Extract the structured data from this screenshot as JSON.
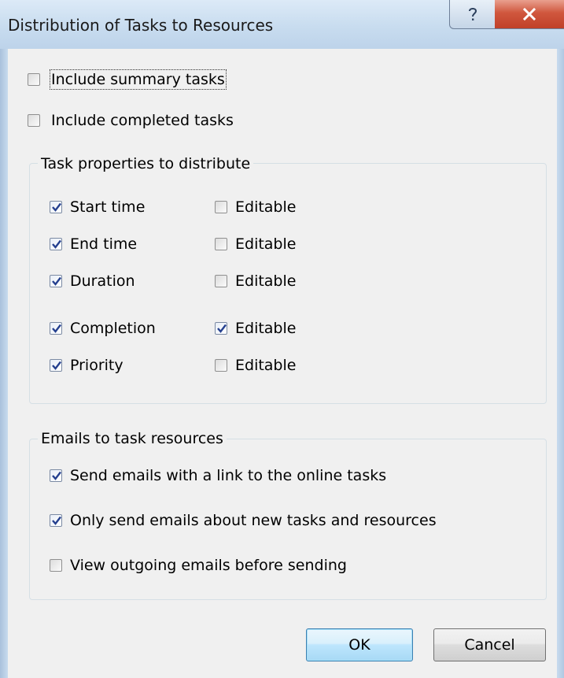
{
  "window": {
    "title": "Distribution of Tasks to Resources",
    "help_glyph": "?",
    "close_glyph": "X"
  },
  "options": {
    "include_summary": {
      "label": "Include summary tasks",
      "checked": false
    },
    "include_completed": {
      "label": "Include completed tasks",
      "checked": false
    }
  },
  "task_properties": {
    "title": "Task properties to distribute",
    "rows": [
      {
        "label": "Start time",
        "checked": true,
        "editable_label": "Editable",
        "editable": false
      },
      {
        "label": "End time",
        "checked": true,
        "editable_label": "Editable",
        "editable": false
      },
      {
        "label": "Duration",
        "checked": true,
        "editable_label": "Editable",
        "editable": false
      },
      {
        "label": "Completion",
        "checked": true,
        "editable_label": "Editable",
        "editable": true
      },
      {
        "label": "Priority",
        "checked": true,
        "editable_label": "Editable",
        "editable": false
      }
    ]
  },
  "emails": {
    "title": "Emails to task resources",
    "items": [
      {
        "label": "Send emails with a link to the online tasks",
        "checked": true
      },
      {
        "label": "Only send emails about new tasks and resources",
        "checked": true
      },
      {
        "label": "View outgoing emails before sending",
        "checked": false
      }
    ]
  },
  "buttons": {
    "ok": "OK",
    "cancel": "Cancel"
  },
  "colors": {
    "titlebar": "#c8dcef",
    "client": "#f0f0f0",
    "close": "#c04028",
    "default_button": "#bee6fd"
  }
}
